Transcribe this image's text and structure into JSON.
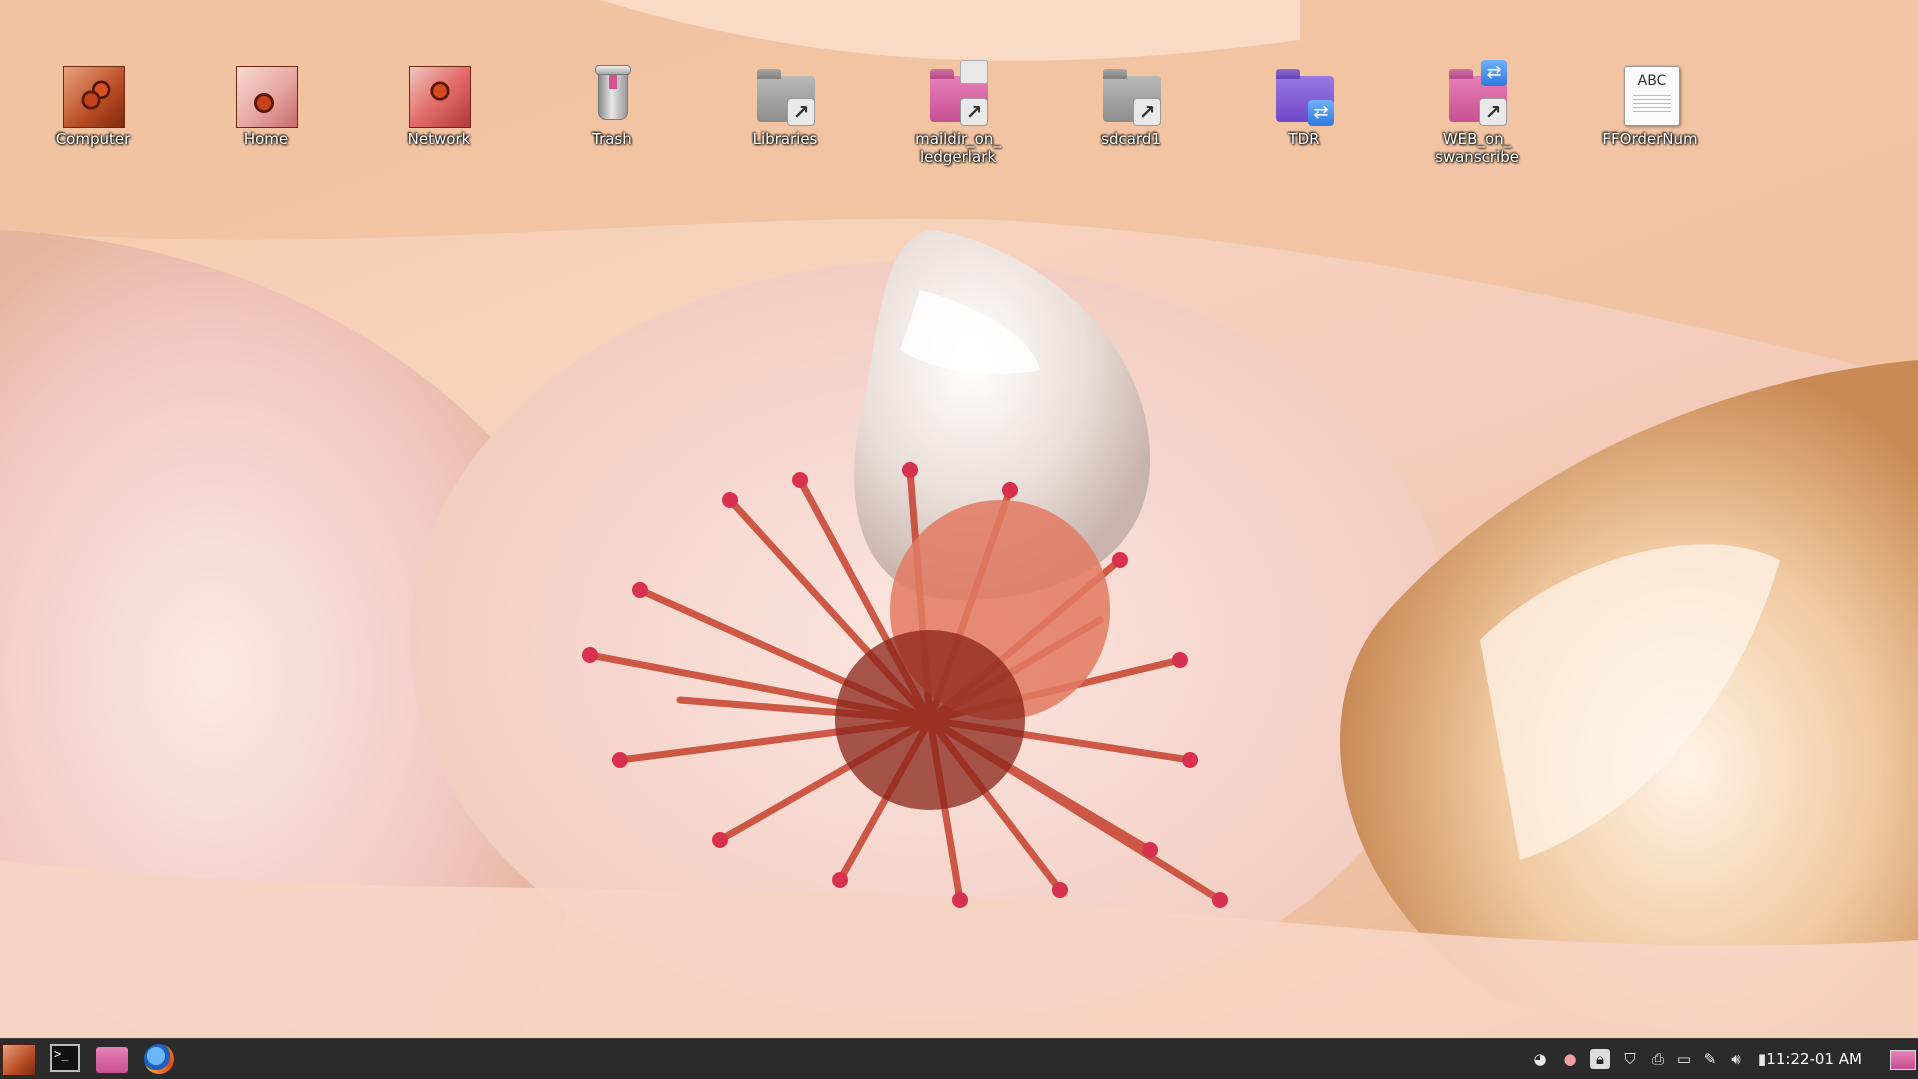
{
  "desktop": {
    "icons": [
      {
        "label": "Computer",
        "icon": "computer-icon"
      },
      {
        "label": "Home",
        "icon": "home-icon"
      },
      {
        "label": "Network",
        "icon": "network-icon"
      },
      {
        "label": "Trash",
        "icon": "trash-icon"
      },
      {
        "label": "Libraries",
        "icon": "folder-link-icon"
      },
      {
        "label": "maildir_on_\nledgerlark",
        "icon": "mail-folder-link-icon"
      },
      {
        "label": "sdcard1",
        "icon": "folder-link-icon"
      },
      {
        "label": "TDR",
        "icon": "network-folder-icon"
      },
      {
        "label": "WEB_on_\nswanscribe",
        "icon": "network-folder-link-icon"
      },
      {
        "label": "FFOrderNum",
        "icon": "text-document-icon"
      }
    ]
  },
  "taskbar": {
    "launchers": [
      "menu-icon",
      "terminal-icon",
      "file-manager-icon",
      "firefox-icon"
    ],
    "tray_icons": [
      "network-status-icon",
      "notification-icon",
      "lock-icon",
      "shield-icon",
      "printer-icon",
      "drive-icon",
      "pen-icon",
      "volume-icon",
      "battery-icon"
    ],
    "clock": "11:22-01 AM"
  },
  "colors": {
    "taskbar_bg": "#2b2b2b",
    "label_text": "#ffffff"
  }
}
